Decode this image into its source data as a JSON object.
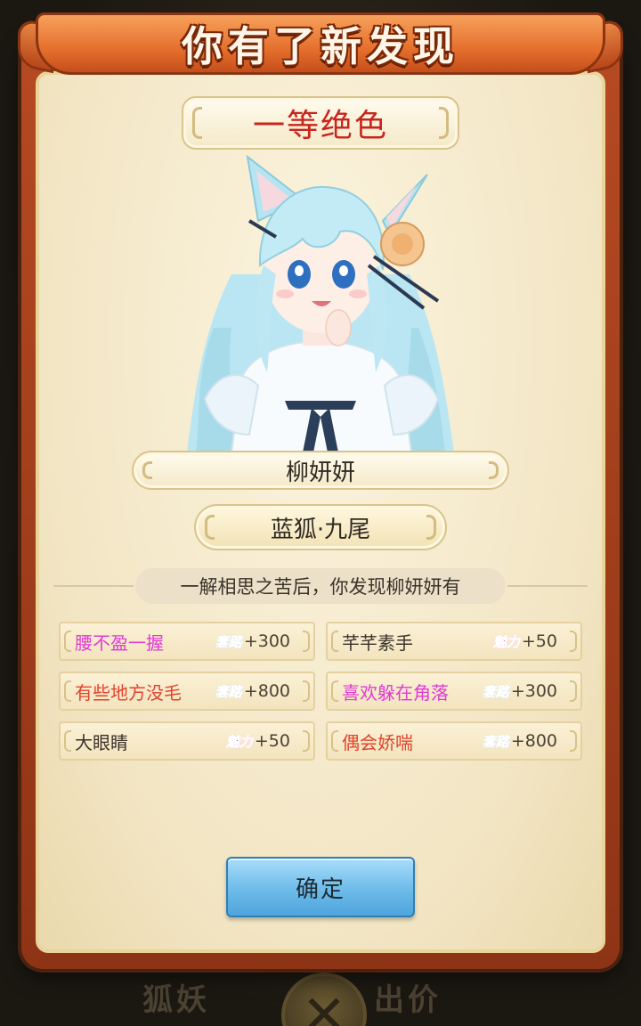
{
  "dialog": {
    "title": "你有了新发现",
    "rank": "一等绝色",
    "character_name": "柳妍妍",
    "character_type": "蓝狐·九尾",
    "description": "一解相思之苦后，你发现柳妍妍有"
  },
  "traits": [
    {
      "name": "腰不盈一握",
      "name_color": "#e03ad6",
      "badge": "套路",
      "badge_kind": "tl",
      "value": "+300"
    },
    {
      "name": "芊芊素手",
      "name_color": "#3a332a",
      "badge": "魅力",
      "badge_kind": "ml",
      "value": "+50"
    },
    {
      "name": "有些地方没毛",
      "name_color": "#e2422b",
      "badge": "套路",
      "badge_kind": "tl",
      "value": "+800"
    },
    {
      "name": "喜欢躲在角落",
      "name_color": "#e03ad6",
      "badge": "套路",
      "badge_kind": "tl",
      "value": "+300"
    },
    {
      "name": "大眼睛",
      "name_color": "#3a332a",
      "badge": "魅力",
      "badge_kind": "ml",
      "value": "+50"
    },
    {
      "name": "偶会娇喘",
      "name_color": "#e2422b",
      "badge": "套路",
      "badge_kind": "tl",
      "value": "+800"
    }
  ],
  "confirm_label": "确定",
  "background": {
    "left_text": "狐妖",
    "right_text": "出价",
    "close_icon": "close-icon"
  },
  "colors": {
    "frame": "#b64a22",
    "panel": "#f3e9cc",
    "rank_text": "#c9251c",
    "button": "#6dbbe9"
  }
}
